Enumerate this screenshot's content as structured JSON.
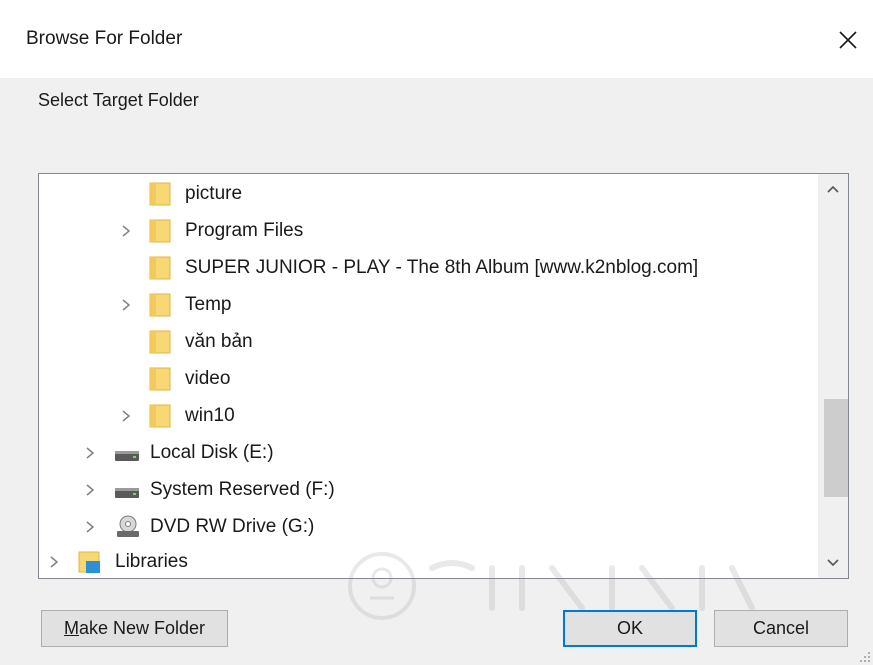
{
  "window": {
    "title": "Browse For Folder",
    "close_icon": "close-icon"
  },
  "prompt": "Select Target Folder",
  "tree": {
    "items": [
      {
        "label": "picture",
        "icon": "folder-icon",
        "expandable": false
      },
      {
        "label": "Program Files",
        "icon": "folder-icon",
        "expandable": true
      },
      {
        "label": "SUPER JUNIOR - PLAY - The 8th Album [www.k2nblog.com]",
        "icon": "folder-icon",
        "expandable": false
      },
      {
        "label": "Temp",
        "icon": "folder-icon",
        "expandable": true
      },
      {
        "label": "văn bản",
        "icon": "folder-icon",
        "expandable": false
      },
      {
        "label": "video",
        "icon": "folder-icon",
        "expandable": false
      },
      {
        "label": "win10",
        "icon": "folder-icon",
        "expandable": true
      },
      {
        "label": "Local Disk (E:)",
        "icon": "drive-icon",
        "expandable": true
      },
      {
        "label": "System Reserved (F:)",
        "icon": "drive-icon",
        "expandable": true
      },
      {
        "label": "DVD RW Drive (G:)",
        "icon": "dvd-drive-icon",
        "expandable": true
      },
      {
        "label": "Libraries",
        "icon": "libraries-icon",
        "expandable": true
      }
    ]
  },
  "buttons": {
    "make_new_folder": {
      "mnemonic": "M",
      "rest": "ake New Folder"
    },
    "ok": "OK",
    "cancel": "Cancel"
  },
  "colors": {
    "folder": "#f8d775",
    "accent": "#0078d7"
  }
}
